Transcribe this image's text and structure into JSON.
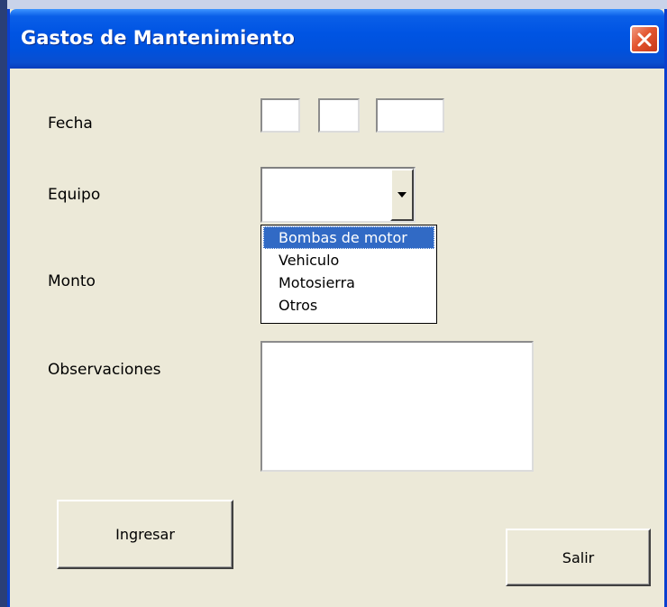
{
  "window": {
    "title": "Gastos de Mantenimiento"
  },
  "form": {
    "fecha_label": "Fecha",
    "equipo_label": "Equipo",
    "monto_label": "Monto",
    "observaciones_label": "Observaciones",
    "fecha_day": "",
    "fecha_month": "",
    "fecha_year": "",
    "equipo_value": "",
    "observaciones_value": ""
  },
  "dropdown": {
    "selected_index": 0,
    "options": [
      "Bombas de motor",
      "Vehiculo",
      "Motosierra",
      "Otros"
    ]
  },
  "buttons": {
    "ingresar_label": "Ingresar",
    "salir_label": "Salir"
  },
  "icons": {
    "close": "close-icon",
    "dropdown": "dropdown-arrow-icon"
  },
  "colors": {
    "titlebar": "#0054e3",
    "selection": "#316ac5",
    "close_button": "#e3552f",
    "dialog_background": "#ece9d8"
  }
}
